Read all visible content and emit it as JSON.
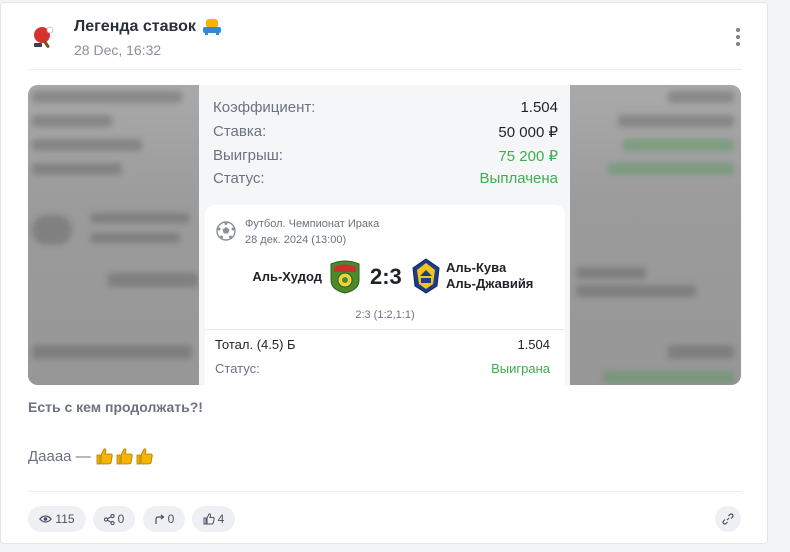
{
  "header": {
    "channel_name": "Легенда ставок",
    "date": "28 Dec, 16:32"
  },
  "bet_slip": {
    "coef_label": "Коэффициент:",
    "coef_value": "1.504",
    "stake_label": "Ставка:",
    "stake_value": "50 000 ₽",
    "win_label": "Выигрыш:",
    "win_value": "75 200 ₽",
    "status_label": "Статус:",
    "status_value": "Выплачена"
  },
  "event": {
    "league": "Футбол. Чемпионат Ирака",
    "date": "28 дек. 2024 (13:00)",
    "home_team": "Аль-Худод",
    "score": "2:3",
    "away_team_line1": "Аль-Кува",
    "away_team_line2": "Аль-Джавийя",
    "halves": "2:3 (1:2,1:1)",
    "market_label": "Тотал. (4.5) Б",
    "market_value": "1.504",
    "status_label": "Статус:",
    "status_value": "Выиграна"
  },
  "post": {
    "title": "Есть с кем продолжать?!",
    "body": "Даааа —"
  },
  "footer": {
    "views": "115",
    "shares": "0",
    "forwards": "0",
    "likes": "4"
  },
  "colors": {
    "win_green": "#3fae4e",
    "muted": "#6b7280",
    "pill_bg": "#eef0f3"
  },
  "icons": [
    "ping-pong-icon",
    "seat-emoji-icon",
    "more-vertical-icon",
    "soccer-ball-icon",
    "eye-icon",
    "share-icon",
    "forward-icon",
    "thumbs-up-icon",
    "link-icon",
    "thumbs-up-emoji-icon"
  ]
}
